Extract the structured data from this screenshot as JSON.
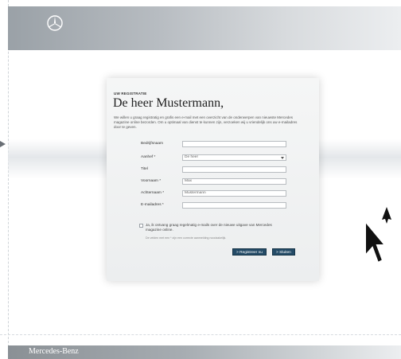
{
  "header": {
    "logo_icon": "mercedes-star-icon"
  },
  "form": {
    "section_label": "UW REGISTRATIE",
    "title": "De heer Mustermann,",
    "intro": "We willen u graag registratig en grafis een e-mail met een overzicht van de onderwerpen van nieuwste Mercedes magazine online bezorden. Om u optimaal van dienst te kunnen zijn, verzoeken wij u vriendelijk ons uw e-mailadres door te geven.",
    "fields": [
      {
        "label": "Bedrijfsnaam",
        "value": ""
      },
      {
        "label": "Aanhef *",
        "value": "De heer"
      },
      {
        "label": "Titel",
        "value": ""
      },
      {
        "label": "Voornaam *",
        "value": "Max"
      },
      {
        "label": "Achternaam *",
        "value": "Mustermann"
      },
      {
        "label": "E-mailadres *",
        "value": ""
      }
    ],
    "consent": "Ja, ik ontvang graag regelmatig e-mails over de nieuwe uitgave van Mercedes magazine online.",
    "consent_note": "De velden met een * zijn een correcte aanmelding noodzakelijk.",
    "register_button": "> Registreer nu",
    "close_button": "> Sluiten"
  },
  "footer": {
    "brand": "Mercedes-Benz"
  },
  "colors": {
    "button": "#244b67"
  }
}
